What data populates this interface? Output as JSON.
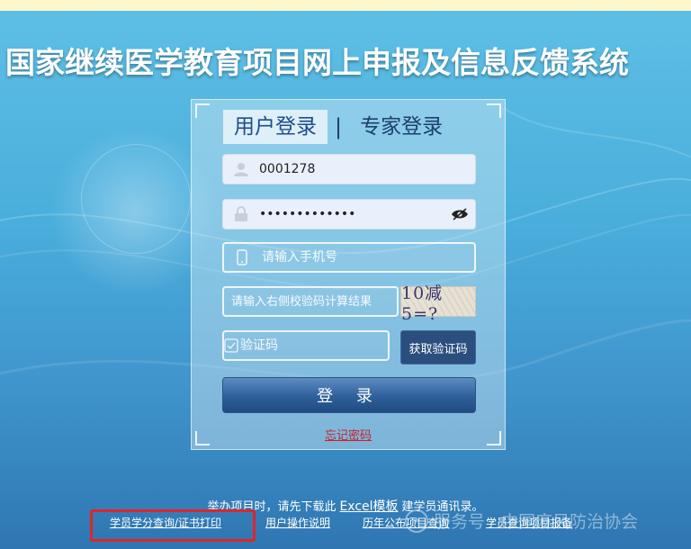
{
  "system_title": "国家继续医学教育项目网上申报及信息反馈系统",
  "tabs": [
    {
      "label": "用户登录",
      "active": true
    },
    {
      "label": "专家登录",
      "active": false
    }
  ],
  "tab_separator": "|",
  "form": {
    "username_value": "0001278",
    "password_value": "•••••••••••••",
    "phone_placeholder": "请输入手机号",
    "calc_placeholder": "请输入右侧校验码计算结果",
    "captcha_text": "10减5=?",
    "sms_code_placeholder": "验证码",
    "get_code_label": "获取验证码",
    "login_label": "登 录",
    "forgot_label": "忘记密码"
  },
  "bottom": {
    "notice_prefix": "举办项目时，请先下载此",
    "excel_link": "Excel模板",
    "notice_suffix": "建学员通讯录。",
    "links": [
      "学员学分查询/证书打印",
      "用户操作说明",
      "历年公布项目查询",
      "学员查询项目报备"
    ]
  },
  "watermark": "服务号 · 中国麻风防治协会",
  "watermark_icon": "wechat-logo",
  "colors": {
    "highlight_box": "#e02525",
    "forgot_link": "#c8232c",
    "button_blue": "#2b4e7e"
  }
}
